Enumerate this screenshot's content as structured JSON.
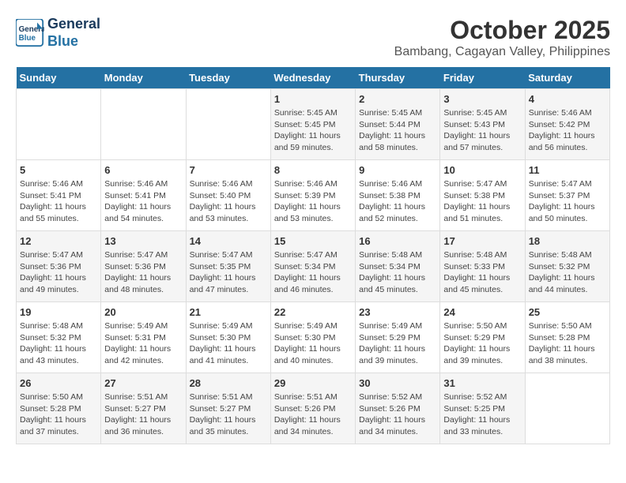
{
  "header": {
    "logo_line1": "General",
    "logo_line2": "Blue",
    "month": "October 2025",
    "location": "Bambang, Cagayan Valley, Philippines"
  },
  "weekdays": [
    "Sunday",
    "Monday",
    "Tuesday",
    "Wednesday",
    "Thursday",
    "Friday",
    "Saturday"
  ],
  "weeks": [
    [
      {
        "day": "",
        "detail": ""
      },
      {
        "day": "",
        "detail": ""
      },
      {
        "day": "",
        "detail": ""
      },
      {
        "day": "1",
        "detail": "Sunrise: 5:45 AM\nSunset: 5:45 PM\nDaylight: 11 hours\nand 59 minutes."
      },
      {
        "day": "2",
        "detail": "Sunrise: 5:45 AM\nSunset: 5:44 PM\nDaylight: 11 hours\nand 58 minutes."
      },
      {
        "day": "3",
        "detail": "Sunrise: 5:45 AM\nSunset: 5:43 PM\nDaylight: 11 hours\nand 57 minutes."
      },
      {
        "day": "4",
        "detail": "Sunrise: 5:46 AM\nSunset: 5:42 PM\nDaylight: 11 hours\nand 56 minutes."
      }
    ],
    [
      {
        "day": "5",
        "detail": "Sunrise: 5:46 AM\nSunset: 5:41 PM\nDaylight: 11 hours\nand 55 minutes."
      },
      {
        "day": "6",
        "detail": "Sunrise: 5:46 AM\nSunset: 5:41 PM\nDaylight: 11 hours\nand 54 minutes."
      },
      {
        "day": "7",
        "detail": "Sunrise: 5:46 AM\nSunset: 5:40 PM\nDaylight: 11 hours\nand 53 minutes."
      },
      {
        "day": "8",
        "detail": "Sunrise: 5:46 AM\nSunset: 5:39 PM\nDaylight: 11 hours\nand 53 minutes."
      },
      {
        "day": "9",
        "detail": "Sunrise: 5:46 AM\nSunset: 5:38 PM\nDaylight: 11 hours\nand 52 minutes."
      },
      {
        "day": "10",
        "detail": "Sunrise: 5:47 AM\nSunset: 5:38 PM\nDaylight: 11 hours\nand 51 minutes."
      },
      {
        "day": "11",
        "detail": "Sunrise: 5:47 AM\nSunset: 5:37 PM\nDaylight: 11 hours\nand 50 minutes."
      }
    ],
    [
      {
        "day": "12",
        "detail": "Sunrise: 5:47 AM\nSunset: 5:36 PM\nDaylight: 11 hours\nand 49 minutes."
      },
      {
        "day": "13",
        "detail": "Sunrise: 5:47 AM\nSunset: 5:36 PM\nDaylight: 11 hours\nand 48 minutes."
      },
      {
        "day": "14",
        "detail": "Sunrise: 5:47 AM\nSunset: 5:35 PM\nDaylight: 11 hours\nand 47 minutes."
      },
      {
        "day": "15",
        "detail": "Sunrise: 5:47 AM\nSunset: 5:34 PM\nDaylight: 11 hours\nand 46 minutes."
      },
      {
        "day": "16",
        "detail": "Sunrise: 5:48 AM\nSunset: 5:34 PM\nDaylight: 11 hours\nand 45 minutes."
      },
      {
        "day": "17",
        "detail": "Sunrise: 5:48 AM\nSunset: 5:33 PM\nDaylight: 11 hours\nand 45 minutes."
      },
      {
        "day": "18",
        "detail": "Sunrise: 5:48 AM\nSunset: 5:32 PM\nDaylight: 11 hours\nand 44 minutes."
      }
    ],
    [
      {
        "day": "19",
        "detail": "Sunrise: 5:48 AM\nSunset: 5:32 PM\nDaylight: 11 hours\nand 43 minutes."
      },
      {
        "day": "20",
        "detail": "Sunrise: 5:49 AM\nSunset: 5:31 PM\nDaylight: 11 hours\nand 42 minutes."
      },
      {
        "day": "21",
        "detail": "Sunrise: 5:49 AM\nSunset: 5:30 PM\nDaylight: 11 hours\nand 41 minutes."
      },
      {
        "day": "22",
        "detail": "Sunrise: 5:49 AM\nSunset: 5:30 PM\nDaylight: 11 hours\nand 40 minutes."
      },
      {
        "day": "23",
        "detail": "Sunrise: 5:49 AM\nSunset: 5:29 PM\nDaylight: 11 hours\nand 39 minutes."
      },
      {
        "day": "24",
        "detail": "Sunrise: 5:50 AM\nSunset: 5:29 PM\nDaylight: 11 hours\nand 39 minutes."
      },
      {
        "day": "25",
        "detail": "Sunrise: 5:50 AM\nSunset: 5:28 PM\nDaylight: 11 hours\nand 38 minutes."
      }
    ],
    [
      {
        "day": "26",
        "detail": "Sunrise: 5:50 AM\nSunset: 5:28 PM\nDaylight: 11 hours\nand 37 minutes."
      },
      {
        "day": "27",
        "detail": "Sunrise: 5:51 AM\nSunset: 5:27 PM\nDaylight: 11 hours\nand 36 minutes."
      },
      {
        "day": "28",
        "detail": "Sunrise: 5:51 AM\nSunset: 5:27 PM\nDaylight: 11 hours\nand 35 minutes."
      },
      {
        "day": "29",
        "detail": "Sunrise: 5:51 AM\nSunset: 5:26 PM\nDaylight: 11 hours\nand 34 minutes."
      },
      {
        "day": "30",
        "detail": "Sunrise: 5:52 AM\nSunset: 5:26 PM\nDaylight: 11 hours\nand 34 minutes."
      },
      {
        "day": "31",
        "detail": "Sunrise: 5:52 AM\nSunset: 5:25 PM\nDaylight: 11 hours\nand 33 minutes."
      },
      {
        "day": "",
        "detail": ""
      }
    ]
  ]
}
